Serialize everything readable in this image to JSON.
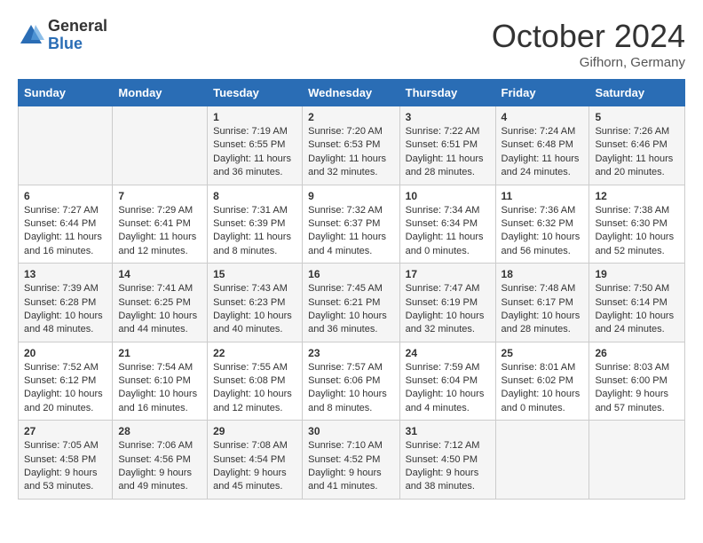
{
  "logo": {
    "general": "General",
    "blue": "Blue"
  },
  "header": {
    "month": "October 2024",
    "location": "Gifhorn, Germany"
  },
  "weekdays": [
    "Sunday",
    "Monday",
    "Tuesday",
    "Wednesday",
    "Thursday",
    "Friday",
    "Saturday"
  ],
  "weeks": [
    [
      {
        "day": "",
        "info": ""
      },
      {
        "day": "",
        "info": ""
      },
      {
        "day": "1",
        "info": "Sunrise: 7:19 AM\nSunset: 6:55 PM\nDaylight: 11 hours and 36 minutes."
      },
      {
        "day": "2",
        "info": "Sunrise: 7:20 AM\nSunset: 6:53 PM\nDaylight: 11 hours and 32 minutes."
      },
      {
        "day": "3",
        "info": "Sunrise: 7:22 AM\nSunset: 6:51 PM\nDaylight: 11 hours and 28 minutes."
      },
      {
        "day": "4",
        "info": "Sunrise: 7:24 AM\nSunset: 6:48 PM\nDaylight: 11 hours and 24 minutes."
      },
      {
        "day": "5",
        "info": "Sunrise: 7:26 AM\nSunset: 6:46 PM\nDaylight: 11 hours and 20 minutes."
      }
    ],
    [
      {
        "day": "6",
        "info": "Sunrise: 7:27 AM\nSunset: 6:44 PM\nDaylight: 11 hours and 16 minutes."
      },
      {
        "day": "7",
        "info": "Sunrise: 7:29 AM\nSunset: 6:41 PM\nDaylight: 11 hours and 12 minutes."
      },
      {
        "day": "8",
        "info": "Sunrise: 7:31 AM\nSunset: 6:39 PM\nDaylight: 11 hours and 8 minutes."
      },
      {
        "day": "9",
        "info": "Sunrise: 7:32 AM\nSunset: 6:37 PM\nDaylight: 11 hours and 4 minutes."
      },
      {
        "day": "10",
        "info": "Sunrise: 7:34 AM\nSunset: 6:34 PM\nDaylight: 11 hours and 0 minutes."
      },
      {
        "day": "11",
        "info": "Sunrise: 7:36 AM\nSunset: 6:32 PM\nDaylight: 10 hours and 56 minutes."
      },
      {
        "day": "12",
        "info": "Sunrise: 7:38 AM\nSunset: 6:30 PM\nDaylight: 10 hours and 52 minutes."
      }
    ],
    [
      {
        "day": "13",
        "info": "Sunrise: 7:39 AM\nSunset: 6:28 PM\nDaylight: 10 hours and 48 minutes."
      },
      {
        "day": "14",
        "info": "Sunrise: 7:41 AM\nSunset: 6:25 PM\nDaylight: 10 hours and 44 minutes."
      },
      {
        "day": "15",
        "info": "Sunrise: 7:43 AM\nSunset: 6:23 PM\nDaylight: 10 hours and 40 minutes."
      },
      {
        "day": "16",
        "info": "Sunrise: 7:45 AM\nSunset: 6:21 PM\nDaylight: 10 hours and 36 minutes."
      },
      {
        "day": "17",
        "info": "Sunrise: 7:47 AM\nSunset: 6:19 PM\nDaylight: 10 hours and 32 minutes."
      },
      {
        "day": "18",
        "info": "Sunrise: 7:48 AM\nSunset: 6:17 PM\nDaylight: 10 hours and 28 minutes."
      },
      {
        "day": "19",
        "info": "Sunrise: 7:50 AM\nSunset: 6:14 PM\nDaylight: 10 hours and 24 minutes."
      }
    ],
    [
      {
        "day": "20",
        "info": "Sunrise: 7:52 AM\nSunset: 6:12 PM\nDaylight: 10 hours and 20 minutes."
      },
      {
        "day": "21",
        "info": "Sunrise: 7:54 AM\nSunset: 6:10 PM\nDaylight: 10 hours and 16 minutes."
      },
      {
        "day": "22",
        "info": "Sunrise: 7:55 AM\nSunset: 6:08 PM\nDaylight: 10 hours and 12 minutes."
      },
      {
        "day": "23",
        "info": "Sunrise: 7:57 AM\nSunset: 6:06 PM\nDaylight: 10 hours and 8 minutes."
      },
      {
        "day": "24",
        "info": "Sunrise: 7:59 AM\nSunset: 6:04 PM\nDaylight: 10 hours and 4 minutes."
      },
      {
        "day": "25",
        "info": "Sunrise: 8:01 AM\nSunset: 6:02 PM\nDaylight: 10 hours and 0 minutes."
      },
      {
        "day": "26",
        "info": "Sunrise: 8:03 AM\nSunset: 6:00 PM\nDaylight: 9 hours and 57 minutes."
      }
    ],
    [
      {
        "day": "27",
        "info": "Sunrise: 7:05 AM\nSunset: 4:58 PM\nDaylight: 9 hours and 53 minutes."
      },
      {
        "day": "28",
        "info": "Sunrise: 7:06 AM\nSunset: 4:56 PM\nDaylight: 9 hours and 49 minutes."
      },
      {
        "day": "29",
        "info": "Sunrise: 7:08 AM\nSunset: 4:54 PM\nDaylight: 9 hours and 45 minutes."
      },
      {
        "day": "30",
        "info": "Sunrise: 7:10 AM\nSunset: 4:52 PM\nDaylight: 9 hours and 41 minutes."
      },
      {
        "day": "31",
        "info": "Sunrise: 7:12 AM\nSunset: 4:50 PM\nDaylight: 9 hours and 38 minutes."
      },
      {
        "day": "",
        "info": ""
      },
      {
        "day": "",
        "info": ""
      }
    ]
  ]
}
